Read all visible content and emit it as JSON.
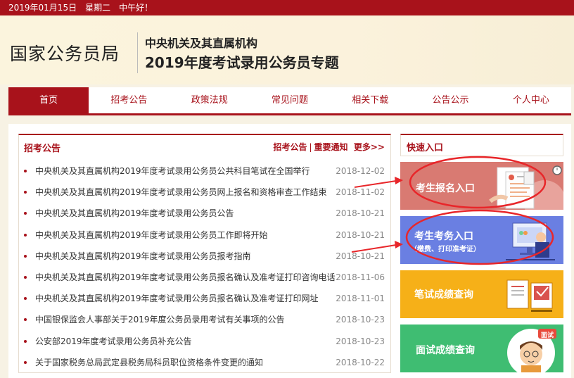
{
  "topbar": {
    "text": "2019年01月15日　星期二　中午好！"
  },
  "header": {
    "org_name": "国家公务员局",
    "sub_title": "中央机关及其直属机构",
    "main_title": "2019年度考试录用公务员专题"
  },
  "nav": {
    "items": [
      {
        "label": "首页"
      },
      {
        "label": "招考公告"
      },
      {
        "label": "政策法规"
      },
      {
        "label": "常见问题"
      },
      {
        "label": "相关下载"
      },
      {
        "label": "公告公示"
      },
      {
        "label": "个人中心"
      }
    ]
  },
  "news": {
    "heading": "招考公告",
    "link_1": "招考公告",
    "separator": "|",
    "link_2": "重要通知",
    "more": "更多>>",
    "items": [
      {
        "title": "中央机关及其直属机构2019年度考试录用公务员公共科目笔试在全国举行",
        "date": "2018-12-02"
      },
      {
        "title": "中央机关及其直属机构2019年度考试录用公务员网上报名和资格审查工作结束",
        "date": "2018-11-02"
      },
      {
        "title": "中央机关及其直属机构2019年度考试录用公务员公告",
        "date": "2018-10-21"
      },
      {
        "title": "中央机关及其直属机构2019年度考试录用公务员工作即将开始",
        "date": "2018-10-21"
      },
      {
        "title": "中央机关及其直属机构2019年度考试录用公务员报考指南",
        "date": "2018-10-21"
      },
      {
        "title": "中央机关及其直属机构2019年度考试录用公务员报名确认及准考证打印咨询电话",
        "date": "2018-11-06"
      },
      {
        "title": "中央机关及其直属机构2019年度考试录用公务员报名确认及准考证打印网址",
        "date": "2018-11-01"
      },
      {
        "title": "中国银保监会人事部关于2019年度公务员录用考试有关事项的公告",
        "date": "2018-10-23"
      },
      {
        "title": "公安部2019年度考试录用公务员补充公告",
        "date": "2018-10-23"
      },
      {
        "title": "关于国家税务总局武定县税务局科员职位资格条件变更的通知",
        "date": "2018-10-22"
      }
    ]
  },
  "quick": {
    "heading": "快速入口",
    "register": {
      "label": "考生报名入口"
    },
    "exam": {
      "label": "考生考务入口",
      "sub": "（缴费、打印准考证）"
    },
    "written": {
      "label": "笔试成绩查询"
    },
    "interview": {
      "label": "面试成绩查询",
      "badge": "面试"
    }
  },
  "colors": {
    "brand_red": "#a8121b",
    "register_card": "#d97a72",
    "exam_card": "#6a7fe2",
    "written_card": "#f6b018",
    "interview_card": "#3fbd72",
    "annotation_red": "#e8262a"
  }
}
